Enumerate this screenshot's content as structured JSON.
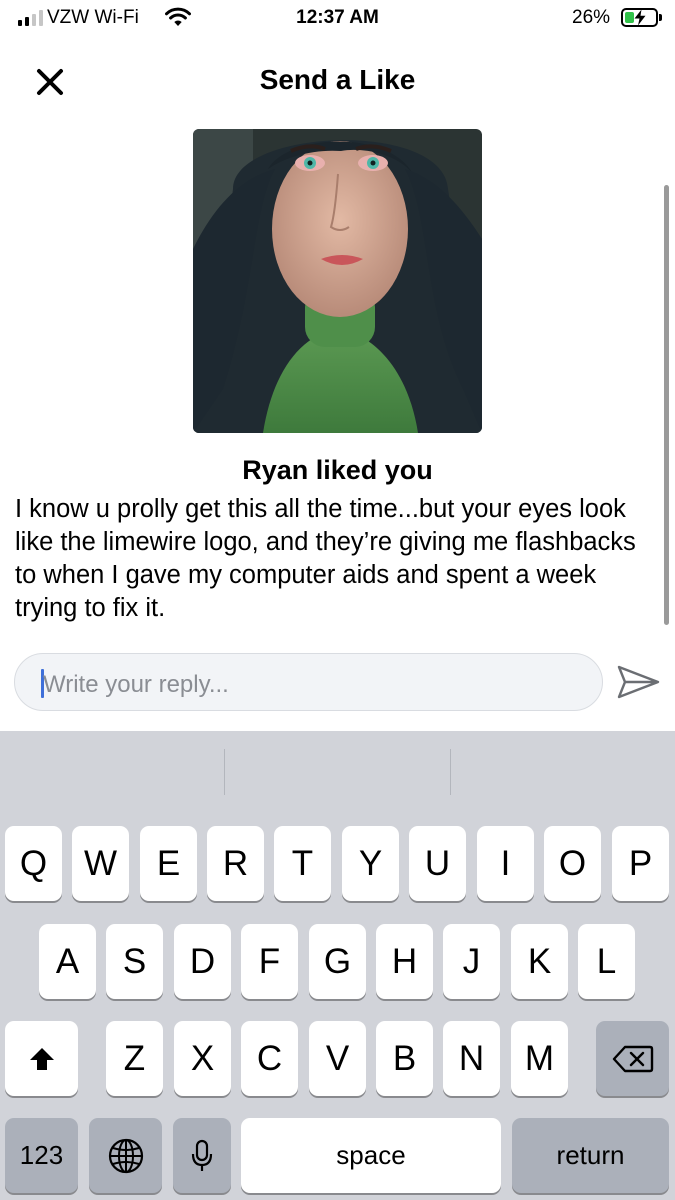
{
  "status_bar": {
    "carrier": "VZW Wi-Fi",
    "time": "12:37 AM",
    "battery_percent": "26%",
    "battery_level": 0.26,
    "charging": true,
    "signal_bars": 2,
    "icons": [
      "signal-icon",
      "wifi-icon",
      "battery-icon"
    ]
  },
  "header": {
    "title": "Send a Like",
    "close_icon": "close-icon"
  },
  "profile": {
    "photo": "profile-photo"
  },
  "like": {
    "title": "Ryan liked you",
    "message": "I know u prolly get this all the time...but your eyes look like the limewire logo, and they’re giving me flashbacks to when I gave my computer aids and spent a week trying to fix it."
  },
  "reply": {
    "value": "",
    "placeholder": "Write your reply...",
    "send_icon": "send-icon"
  },
  "keyboard": {
    "row1": [
      "Q",
      "W",
      "E",
      "R",
      "T",
      "Y",
      "U",
      "I",
      "O",
      "P"
    ],
    "row2": [
      "A",
      "S",
      "D",
      "F",
      "G",
      "H",
      "J",
      "K",
      "L"
    ],
    "row3": [
      "Z",
      "X",
      "C",
      "V",
      "B",
      "N",
      "M"
    ],
    "numbers_label": "123",
    "space_label": "space",
    "return_label": "return",
    "icons": [
      "shift-icon",
      "delete-icon",
      "globe-icon",
      "microphone-icon"
    ]
  },
  "colors": {
    "accent": "#3e6fd9",
    "battery_fill": "#31c24a",
    "keyboard_bg": "#d1d3d9",
    "input_bg": "#f2f4f7"
  }
}
